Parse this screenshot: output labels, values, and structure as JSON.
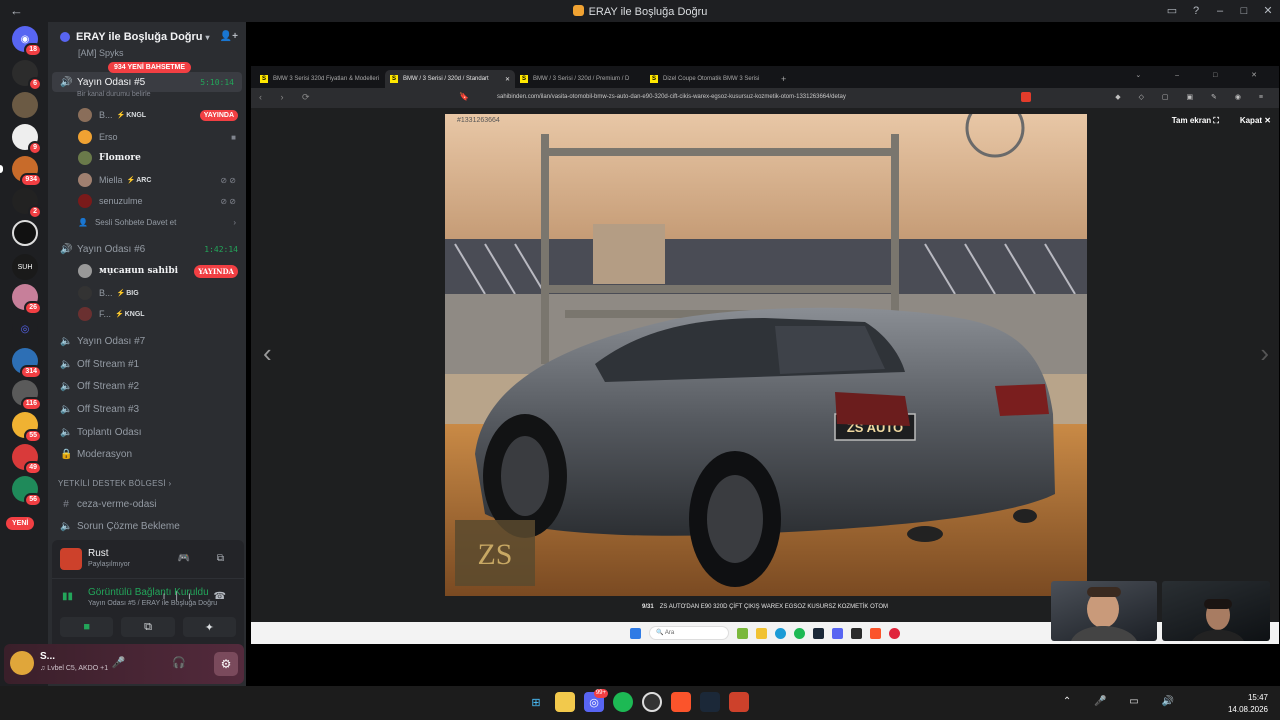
{
  "window": {
    "title": "ERAY ile Boşluğa Doğru"
  },
  "rail": {
    "servers": [
      {
        "badge": "18"
      },
      {
        "badge": "6"
      },
      {
        "badge": ""
      },
      {
        "badge": "9"
      },
      {
        "badge": "934"
      },
      {
        "badge": "2"
      },
      {
        "badge": ""
      },
      {
        "badge": ""
      },
      {
        "badge": "26"
      },
      {
        "badge": ""
      },
      {
        "badge": "314"
      },
      {
        "badge": "116"
      },
      {
        "badge": "55"
      },
      {
        "badge": "49"
      },
      {
        "badge": "56"
      }
    ],
    "new_label": "YENİ"
  },
  "guild": {
    "name": "ERAY ile Boşluğa Doğru",
    "new_pill": "934 YENİ BAHSETME",
    "partial_user": "[AM] Spyks"
  },
  "channels": {
    "stream5": {
      "name": "Yayın Odası #5",
      "timer": "5:10:14",
      "status": "Bir kanal durumu belirle"
    },
    "stream5_users": [
      {
        "name": "B...",
        "tag": "KNGL",
        "live": "YAYINDA"
      },
      {
        "name": "Erso"
      },
      {
        "name": "Flomore"
      },
      {
        "name": "Miella",
        "tag": "ARC"
      },
      {
        "name": "senuzulme"
      },
      {
        "name": "Sesli Sohbete Davet et"
      }
    ],
    "stream6": {
      "name": "Yayın Odası #6",
      "timer": "1:42:14"
    },
    "stream6_users": [
      {
        "name": "мụcaнun sahibi",
        "live": "YAYINDA"
      },
      {
        "name": "B...",
        "tag": "BIG"
      },
      {
        "name": "F...",
        "tag": "KNGL"
      }
    ],
    "others": [
      "Yayın Odası #7",
      "Off Stream #1",
      "Off Stream #2",
      "Off Stream #3",
      "Toplantı Odası",
      "Moderasyon"
    ],
    "category": "YETKİLİ DESTEK BÖLGESİ",
    "text": [
      "ceza-verme-odasi",
      "Sorun Çözme Bekleme"
    ]
  },
  "activity": {
    "game": "Rust",
    "game_sub": "Paylaşılmıyor",
    "voice_status": "Görüntülü Bağlantı Kuruldu",
    "voice_location": "Yayın Odası #5 / ERAY ile Boşluğa Doğru"
  },
  "user_panel": {
    "name": "S...",
    "status": "♫ Lvbel C5, AKDO +1"
  },
  "browser": {
    "tabs": [
      {
        "label": "BMW 3 Serisi 320d Fiyatları & Modelleri"
      },
      {
        "label": "BMW / 3 Serisi / 320d / Standart"
      },
      {
        "label": "BMW / 3 Serisi / 320d / Premium / D"
      },
      {
        "label": "Dizel Coupe Otomatik BMW 3 Serisi"
      }
    ],
    "url": "sahibinden.com/ilan/vasita-otomobil-bmw-zs-auto-dan-e90-320d-cift-cikis-warex-egsoz-kusursuz-kozmetik-otom-1331263664/detay",
    "fullscreen": "Tam ekran",
    "close": "Kapat",
    "listing_id": "#1331263664",
    "counter": "9/31",
    "caption": "ZS AUTO'DAN E90 320D ÇİFT ÇIKIŞ WAREX EGSOZ KUSURSZ KOZMETİK OTOM",
    "plate": "ZS AUTO",
    "search": "Ara"
  },
  "taskbar": {
    "time": "15:47",
    "date": "14.08.2026",
    "discord_badge": "99+"
  },
  "colors": {
    "discord_bg": "#2b2d31",
    "rail_bg": "#1e1f22",
    "live": "#f23f43",
    "voice_green": "#23a55a"
  }
}
